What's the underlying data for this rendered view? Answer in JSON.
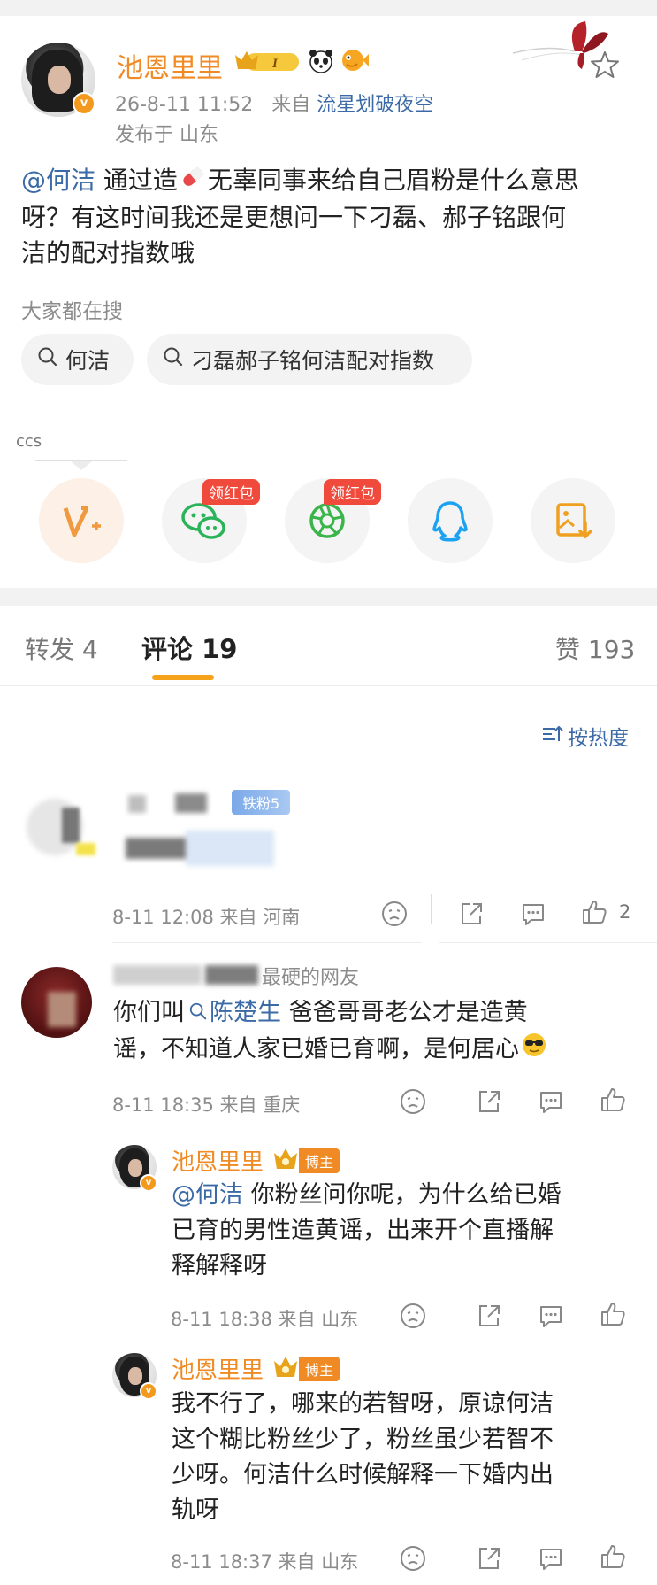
{
  "post": {
    "author": "池恩里里",
    "level_badge": "I",
    "time": "26-8-11 11:52",
    "source_prefix": "来自",
    "source": "流星划破夜空",
    "location": "发布于 山东",
    "mention": "@何洁",
    "text_a": " 通过造",
    "text_b": "无辜同事来给自己眉粉是什么意思",
    "text_line2": "呀？有这时间我还是更想问一下刁磊、郝子铭跟何",
    "text_line3": "洁的配对指数哦"
  },
  "search": {
    "label": "大家都在搜",
    "chips": [
      "何洁",
      "刁磊郝子铭何洁配对指数"
    ]
  },
  "share": {
    "label": "ccs",
    "redpacket": "领红包"
  },
  "tabs": {
    "repost": "转发 4",
    "comments": "评论 19",
    "likes": "赞 193"
  },
  "sort": {
    "label": "按热度"
  },
  "comments": [
    {
      "fan_badge": "铁粉5",
      "meta": "8-11 12:08  来自 河南",
      "likes": "2"
    },
    {
      "name_partial": "最硬的网友",
      "text_a": "你们叫",
      "search_term": "陈楚生",
      "text_b": " 爸爸哥哥老公才是造黄",
      "text_line2": "谣，不知道人家已婚已育啊，是何居心",
      "meta": "8-11 18:35  来自 重庆"
    },
    {
      "name": "池恩里里",
      "badge": "博主",
      "mention": "@何洁",
      "text_a": " 你粉丝问你呢，为什么给已婚",
      "text_line2": "已育的男性造黄谣，出来开个直播解",
      "text_line3": "释解释呀",
      "meta": "8-11 18:38  来自 山东"
    },
    {
      "name": "池恩里里",
      "badge": "博主",
      "text_line1": "我不行了，哪来的若智呀，原谅何洁",
      "text_line2": "这个糊比粉丝少了，粉丝虽少若智不",
      "text_line3": "少呀。何洁什么时候解释一下婚内出",
      "text_line4": "轨呀",
      "meta": "8-11 18:37  来自 山东"
    }
  ],
  "colors": {
    "accent": "#f08a24",
    "link": "#3b6aa6",
    "red": "#f04a3c"
  }
}
